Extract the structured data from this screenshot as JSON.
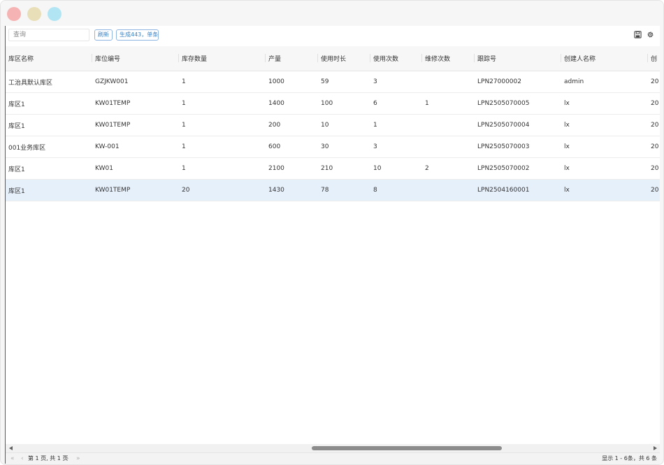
{
  "toolbar": {
    "search_placeholder": "查询",
    "refresh_label": "刷新",
    "generate_label": "生成443，单条",
    "icons": [
      "save-icon",
      "gear-icon"
    ]
  },
  "table": {
    "columns": [
      "库区名称",
      "库位编号",
      "库存数量",
      "产量",
      "使用时长",
      "使用次数",
      "维修次数",
      "跟踪号",
      "创建人名称",
      "创"
    ],
    "rows": [
      [
        "工治具默认库区",
        "GZJKW001",
        "1",
        "1000",
        "59",
        "3",
        "",
        "LPN27000002",
        "admin",
        "20"
      ],
      [
        "库区1",
        "KW01TEMP",
        "1",
        "1400",
        "100",
        "6",
        "1",
        "LPN2505070005",
        "lx",
        "20"
      ],
      [
        "库区1",
        "KW01TEMP",
        "1",
        "200",
        "10",
        "1",
        "",
        "LPN2505070004",
        "lx",
        "20"
      ],
      [
        "001业务库区",
        "KW-001",
        "1",
        "600",
        "30",
        "3",
        "",
        "LPN2505070003",
        "lx",
        "20"
      ],
      [
        "库区1",
        "KW01",
        "1",
        "2100",
        "210",
        "10",
        "2",
        "LPN2505070002",
        "lx",
        "20"
      ],
      [
        "库区1",
        "KW01TEMP",
        "20",
        "1430",
        "78",
        "8",
        "",
        "LPN2504160001",
        "lx",
        "20"
      ]
    ],
    "selected_row": 5
  },
  "pager": {
    "page_info": "第 1 页, 共 1 页",
    "summary": "显示 1 - 6条，共 6 条",
    "icons": [
      "first-page-icon",
      "prev-page-icon",
      "next-page-icon",
      "last-page-icon"
    ]
  },
  "colors": {
    "accent": "#3b82c4",
    "selected_row": "#e6f0fb",
    "traffic_red": "#f6b3b3",
    "traffic_yellow": "#e8dfb8",
    "traffic_green": "#b2e5f3"
  }
}
